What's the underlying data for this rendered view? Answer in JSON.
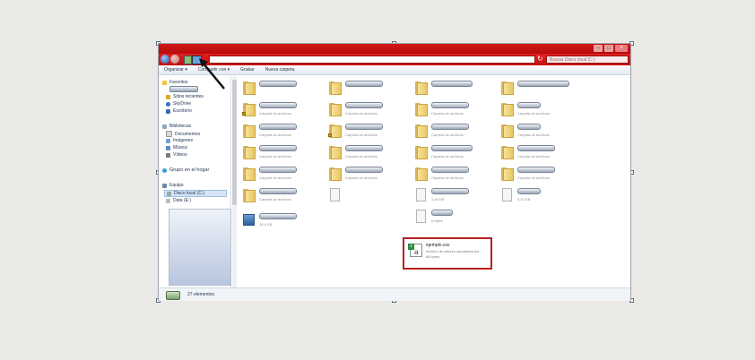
{
  "window": {
    "search_placeholder": "Buscar Disco local (C:)",
    "buttons": {
      "min": "–",
      "max": "□",
      "close": "×"
    }
  },
  "toolbar": {
    "organize": "Organizar ▾",
    "share": "Compartir con ▾",
    "burn": "Grabar",
    "new_folder": "Nueva carpeta"
  },
  "sidebar": {
    "favorites": "Favoritos",
    "recent": "Sitios recientes",
    "skydrive": "SkyDrive",
    "desktop": "Escritorio",
    "libraries": "Bibliotecas",
    "documents": "Documentos",
    "images": "Imágenes",
    "music": "Música",
    "videos": "Vídeos",
    "homegroup": "Grupo en el hogar",
    "computer": "Equipo",
    "local_disk": "Disco local (C:)",
    "data_disk": "Data (E:)"
  },
  "files": {
    "folder_type": "Carpeta de archivos",
    "csv_name": "ejemplo.csv",
    "csv_type": "Archivo de valores separados por...",
    "csv_size": "66 bytes",
    "size_exe": "10,4 KB",
    "size_doc1": "1,00 KB",
    "size_doc2": "0 bytes",
    "size_doc3": "4,43 KB"
  },
  "status": {
    "count": "27 elementos"
  },
  "colors": {
    "titlebar": "#c71010",
    "highlight": "#b72020"
  }
}
